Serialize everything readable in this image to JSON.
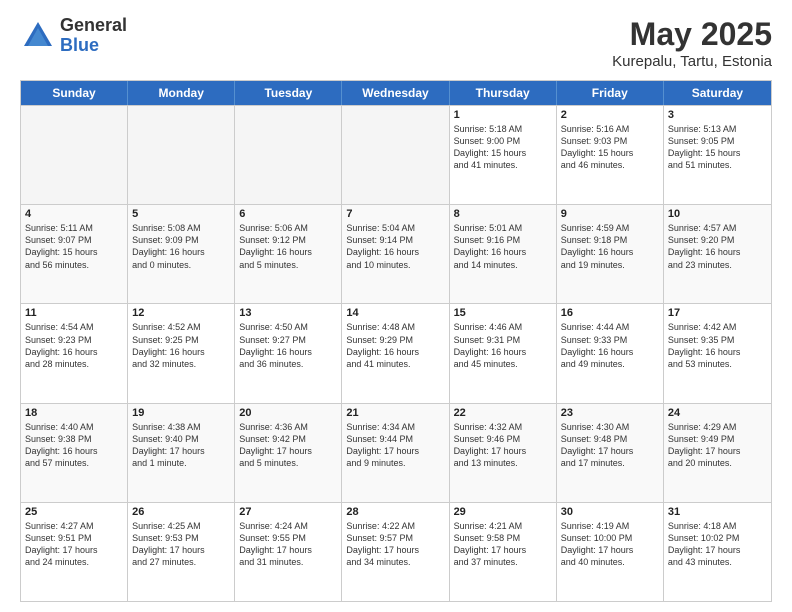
{
  "header": {
    "logo_general": "General",
    "logo_blue": "Blue",
    "title": "May 2025",
    "subtitle": "Kurepalu, Tartu, Estonia"
  },
  "weekdays": [
    "Sunday",
    "Monday",
    "Tuesday",
    "Wednesday",
    "Thursday",
    "Friday",
    "Saturday"
  ],
  "rows": [
    [
      {
        "day": "",
        "info": "",
        "empty": true
      },
      {
        "day": "",
        "info": "",
        "empty": true
      },
      {
        "day": "",
        "info": "",
        "empty": true
      },
      {
        "day": "",
        "info": "",
        "empty": true
      },
      {
        "day": "1",
        "info": "Sunrise: 5:18 AM\nSunset: 9:00 PM\nDaylight: 15 hours\nand 41 minutes.",
        "empty": false
      },
      {
        "day": "2",
        "info": "Sunrise: 5:16 AM\nSunset: 9:03 PM\nDaylight: 15 hours\nand 46 minutes.",
        "empty": false
      },
      {
        "day": "3",
        "info": "Sunrise: 5:13 AM\nSunset: 9:05 PM\nDaylight: 15 hours\nand 51 minutes.",
        "empty": false
      }
    ],
    [
      {
        "day": "4",
        "info": "Sunrise: 5:11 AM\nSunset: 9:07 PM\nDaylight: 15 hours\nand 56 minutes.",
        "empty": false
      },
      {
        "day": "5",
        "info": "Sunrise: 5:08 AM\nSunset: 9:09 PM\nDaylight: 16 hours\nand 0 minutes.",
        "empty": false
      },
      {
        "day": "6",
        "info": "Sunrise: 5:06 AM\nSunset: 9:12 PM\nDaylight: 16 hours\nand 5 minutes.",
        "empty": false
      },
      {
        "day": "7",
        "info": "Sunrise: 5:04 AM\nSunset: 9:14 PM\nDaylight: 16 hours\nand 10 minutes.",
        "empty": false
      },
      {
        "day": "8",
        "info": "Sunrise: 5:01 AM\nSunset: 9:16 PM\nDaylight: 16 hours\nand 14 minutes.",
        "empty": false
      },
      {
        "day": "9",
        "info": "Sunrise: 4:59 AM\nSunset: 9:18 PM\nDaylight: 16 hours\nand 19 minutes.",
        "empty": false
      },
      {
        "day": "10",
        "info": "Sunrise: 4:57 AM\nSunset: 9:20 PM\nDaylight: 16 hours\nand 23 minutes.",
        "empty": false
      }
    ],
    [
      {
        "day": "11",
        "info": "Sunrise: 4:54 AM\nSunset: 9:23 PM\nDaylight: 16 hours\nand 28 minutes.",
        "empty": false
      },
      {
        "day": "12",
        "info": "Sunrise: 4:52 AM\nSunset: 9:25 PM\nDaylight: 16 hours\nand 32 minutes.",
        "empty": false
      },
      {
        "day": "13",
        "info": "Sunrise: 4:50 AM\nSunset: 9:27 PM\nDaylight: 16 hours\nand 36 minutes.",
        "empty": false
      },
      {
        "day": "14",
        "info": "Sunrise: 4:48 AM\nSunset: 9:29 PM\nDaylight: 16 hours\nand 41 minutes.",
        "empty": false
      },
      {
        "day": "15",
        "info": "Sunrise: 4:46 AM\nSunset: 9:31 PM\nDaylight: 16 hours\nand 45 minutes.",
        "empty": false
      },
      {
        "day": "16",
        "info": "Sunrise: 4:44 AM\nSunset: 9:33 PM\nDaylight: 16 hours\nand 49 minutes.",
        "empty": false
      },
      {
        "day": "17",
        "info": "Sunrise: 4:42 AM\nSunset: 9:35 PM\nDaylight: 16 hours\nand 53 minutes.",
        "empty": false
      }
    ],
    [
      {
        "day": "18",
        "info": "Sunrise: 4:40 AM\nSunset: 9:38 PM\nDaylight: 16 hours\nand 57 minutes.",
        "empty": false
      },
      {
        "day": "19",
        "info": "Sunrise: 4:38 AM\nSunset: 9:40 PM\nDaylight: 17 hours\nand 1 minute.",
        "empty": false
      },
      {
        "day": "20",
        "info": "Sunrise: 4:36 AM\nSunset: 9:42 PM\nDaylight: 17 hours\nand 5 minutes.",
        "empty": false
      },
      {
        "day": "21",
        "info": "Sunrise: 4:34 AM\nSunset: 9:44 PM\nDaylight: 17 hours\nand 9 minutes.",
        "empty": false
      },
      {
        "day": "22",
        "info": "Sunrise: 4:32 AM\nSunset: 9:46 PM\nDaylight: 17 hours\nand 13 minutes.",
        "empty": false
      },
      {
        "day": "23",
        "info": "Sunrise: 4:30 AM\nSunset: 9:48 PM\nDaylight: 17 hours\nand 17 minutes.",
        "empty": false
      },
      {
        "day": "24",
        "info": "Sunrise: 4:29 AM\nSunset: 9:49 PM\nDaylight: 17 hours\nand 20 minutes.",
        "empty": false
      }
    ],
    [
      {
        "day": "25",
        "info": "Sunrise: 4:27 AM\nSunset: 9:51 PM\nDaylight: 17 hours\nand 24 minutes.",
        "empty": false
      },
      {
        "day": "26",
        "info": "Sunrise: 4:25 AM\nSunset: 9:53 PM\nDaylight: 17 hours\nand 27 minutes.",
        "empty": false
      },
      {
        "day": "27",
        "info": "Sunrise: 4:24 AM\nSunset: 9:55 PM\nDaylight: 17 hours\nand 31 minutes.",
        "empty": false
      },
      {
        "day": "28",
        "info": "Sunrise: 4:22 AM\nSunset: 9:57 PM\nDaylight: 17 hours\nand 34 minutes.",
        "empty": false
      },
      {
        "day": "29",
        "info": "Sunrise: 4:21 AM\nSunset: 9:58 PM\nDaylight: 17 hours\nand 37 minutes.",
        "empty": false
      },
      {
        "day": "30",
        "info": "Sunrise: 4:19 AM\nSunset: 10:00 PM\nDaylight: 17 hours\nand 40 minutes.",
        "empty": false
      },
      {
        "day": "31",
        "info": "Sunrise: 4:18 AM\nSunset: 10:02 PM\nDaylight: 17 hours\nand 43 minutes.",
        "empty": false
      }
    ]
  ]
}
